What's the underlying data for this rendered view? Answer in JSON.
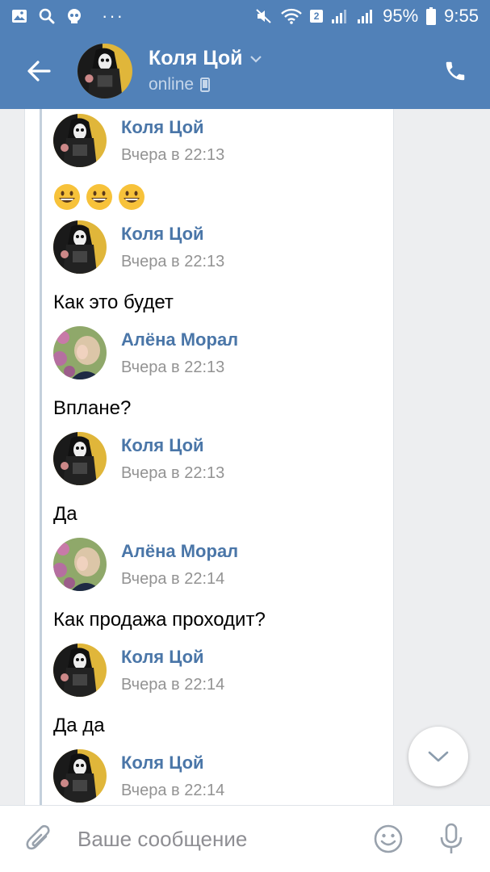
{
  "status_bar": {
    "icons_left": [
      "gallery-icon",
      "search-icon",
      "skull-icon"
    ],
    "dots": "···",
    "sim_number": "2",
    "battery": "95%",
    "time": "9:55"
  },
  "header": {
    "name": "Коля Цой",
    "status": "online"
  },
  "messages": [
    {
      "name": "Коля Цой",
      "time": "Вчера в 22:13",
      "text": "",
      "emojis": [
        "😀",
        "😀",
        "😀"
      ],
      "avatar": "skull"
    },
    {
      "name": "Коля Цой",
      "time": "Вчера в 22:13",
      "text": "Как это будет",
      "avatar": "skull"
    },
    {
      "name": "Алёна Морал",
      "time": "Вчера в 22:13",
      "text": "Вплане?",
      "avatar": "girl"
    },
    {
      "name": "Коля Цой",
      "time": "Вчера в 22:13",
      "text": "Да",
      "avatar": "skull"
    },
    {
      "name": "Алёна Морал",
      "time": "Вчера в 22:14",
      "text": "Как продажа проходит?",
      "avatar": "girl"
    },
    {
      "name": "Коля Цой",
      "time": "Вчера в 22:14",
      "text": "Да да",
      "avatar": "skull"
    },
    {
      "name": "Коля Цой",
      "time": "Вчера в 22:14",
      "text": "",
      "avatar": "skull"
    }
  ],
  "composer": {
    "placeholder": "Ваше сообщение"
  },
  "colors": {
    "header_bg": "#5181b8",
    "name_link": "#4a76a8",
    "time_gray": "#939393",
    "background": "#edeef0"
  }
}
